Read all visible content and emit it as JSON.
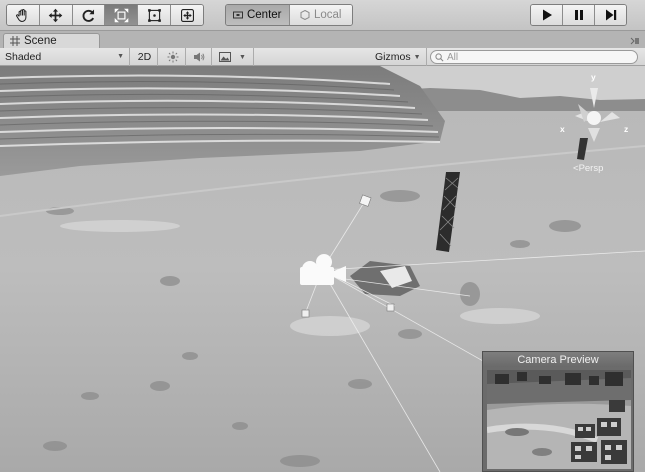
{
  "toolbar": {
    "tools": [
      {
        "name": "hand-tool",
        "icon": "hand-icon"
      },
      {
        "name": "move-tool",
        "icon": "move-arrows-icon"
      },
      {
        "name": "rotate-tool",
        "icon": "rotate-icon"
      },
      {
        "name": "scale-tool",
        "icon": "scale-icon",
        "active": true
      },
      {
        "name": "rect-tool",
        "icon": "rect-icon"
      },
      {
        "name": "transform-tool",
        "icon": "transform-icon"
      }
    ],
    "pivot_center_label": "Center",
    "pivot_local_label": "Local",
    "play_icons": [
      "play-icon",
      "pause-icon",
      "step-icon"
    ]
  },
  "tab": {
    "label": "Scene"
  },
  "scene_toolbar": {
    "draw_mode": "Shaded",
    "mode_2d_label": "2D",
    "gizmos_label": "Gizmos",
    "search_placeholder": "All"
  },
  "viewport": {
    "persp_label": "Persp",
    "axis_labels": {
      "x": "x",
      "y": "y",
      "z": "z"
    },
    "camera_preview_title": "Camera Preview"
  }
}
